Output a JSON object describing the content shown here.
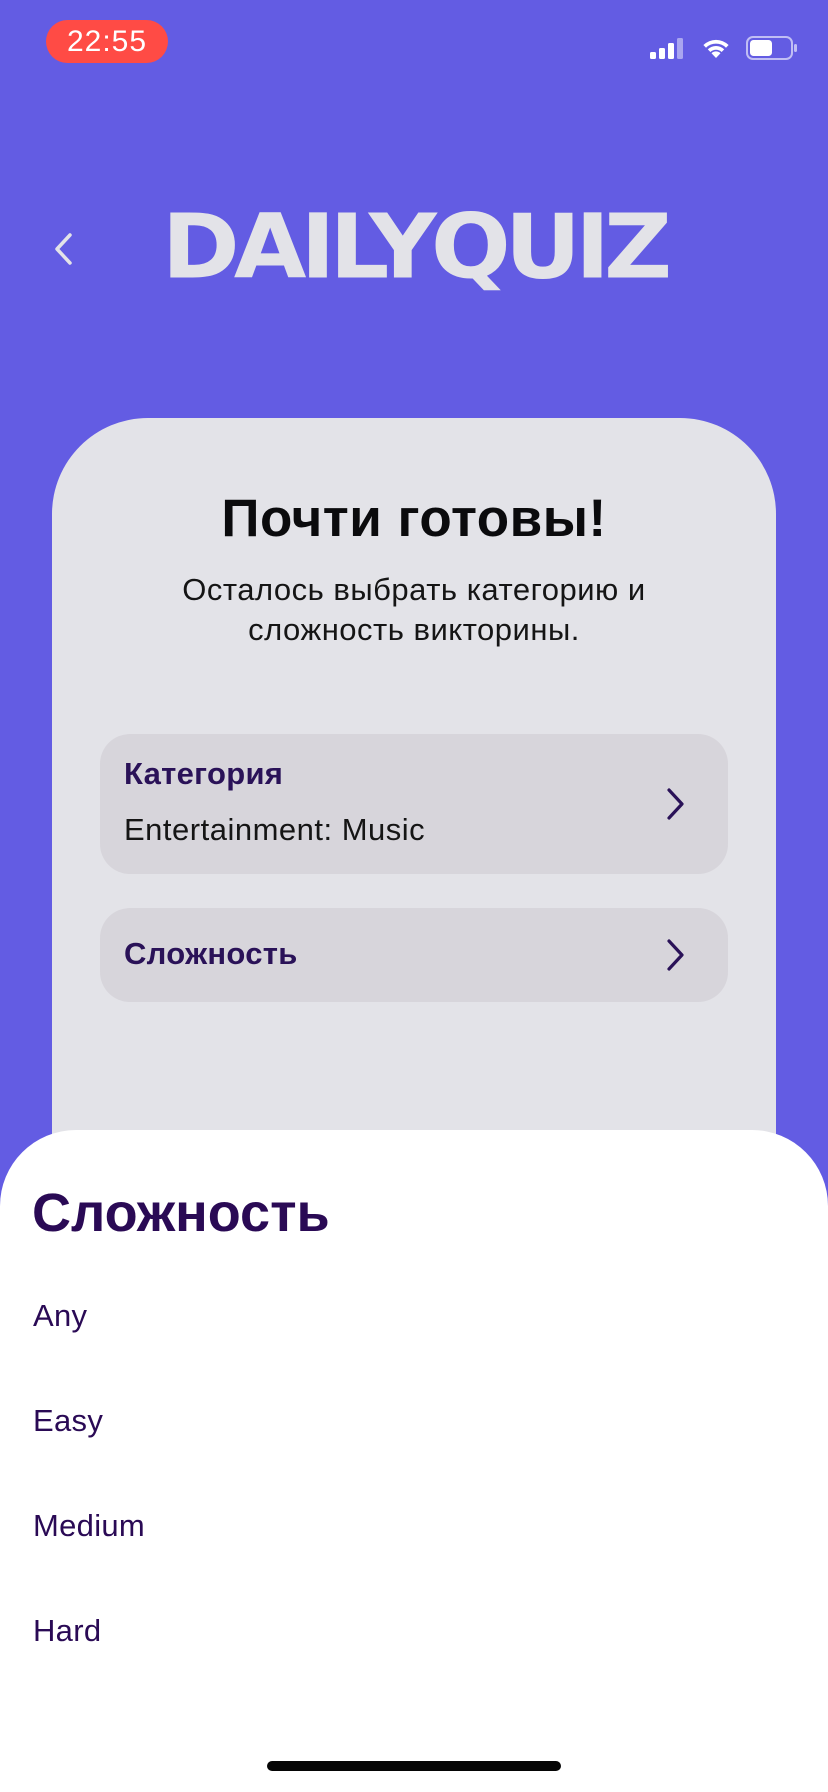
{
  "status_bar": {
    "time": "22:55"
  },
  "header": {
    "logo_text": "DAILYQUIZ"
  },
  "card": {
    "title": "Почти готовы!",
    "subtitle_line1": "Осталось выбрать категорию и",
    "subtitle_line2": "сложность викторины.",
    "category": {
      "label": "Категория",
      "value": "Entertainment: Music"
    },
    "difficulty": {
      "label": "Сложность"
    }
  },
  "sheet": {
    "title": "Сложность",
    "options": [
      "Any",
      "Easy",
      "Medium",
      "Hard"
    ]
  },
  "colors": {
    "background": "#635CE3",
    "card": "#E3E3E8",
    "accent_text": "#2A0A55",
    "time_pill": "#FF4B45"
  },
  "icons": [
    "back-chevron-icon",
    "chevron-right-icon",
    "cellular-signal-icon",
    "wifi-icon",
    "battery-icon"
  ]
}
